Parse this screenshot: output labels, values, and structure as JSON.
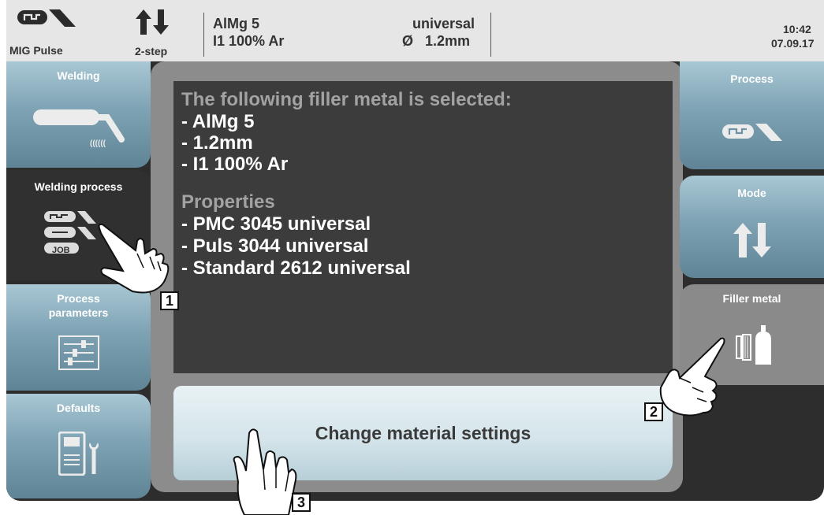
{
  "status_bar": {
    "process_name": "MIG Pulse",
    "mode_name": "2-step",
    "material": "AlMg 5",
    "gas": "I1 100% Ar",
    "characteristic": "universal",
    "diameter_symbol": "Ø",
    "diameter": "1.2mm",
    "time": "10:42",
    "date": "07.09.17"
  },
  "left_menu": [
    {
      "label": "Welding"
    },
    {
      "label": "Welding process",
      "active": true,
      "job_label": "JOB"
    },
    {
      "label": "Process parameters"
    },
    {
      "label": "Defaults"
    }
  ],
  "right_menu": [
    {
      "label": "Process"
    },
    {
      "label": "Mode"
    },
    {
      "label": "Filler metal",
      "active": true
    }
  ],
  "info": {
    "heading": "The following filler metal is selected:",
    "selected": [
      "- AlMg 5",
      "- 1.2mm",
      "- I1 100% Ar"
    ],
    "properties_heading": "Properties",
    "properties": [
      "- PMC 3045 universal",
      "- Puls 3044 universal",
      "- Standard 2612 universal"
    ]
  },
  "change_button": {
    "label": "Change material settings"
  },
  "callouts": [
    "1",
    "2",
    "3"
  ],
  "colors": {
    "panel_dark": "#2d2d2d",
    "button_blue": "#7ea3b4",
    "active_dark": "#303030",
    "active_gray": "#8a8a8a"
  }
}
